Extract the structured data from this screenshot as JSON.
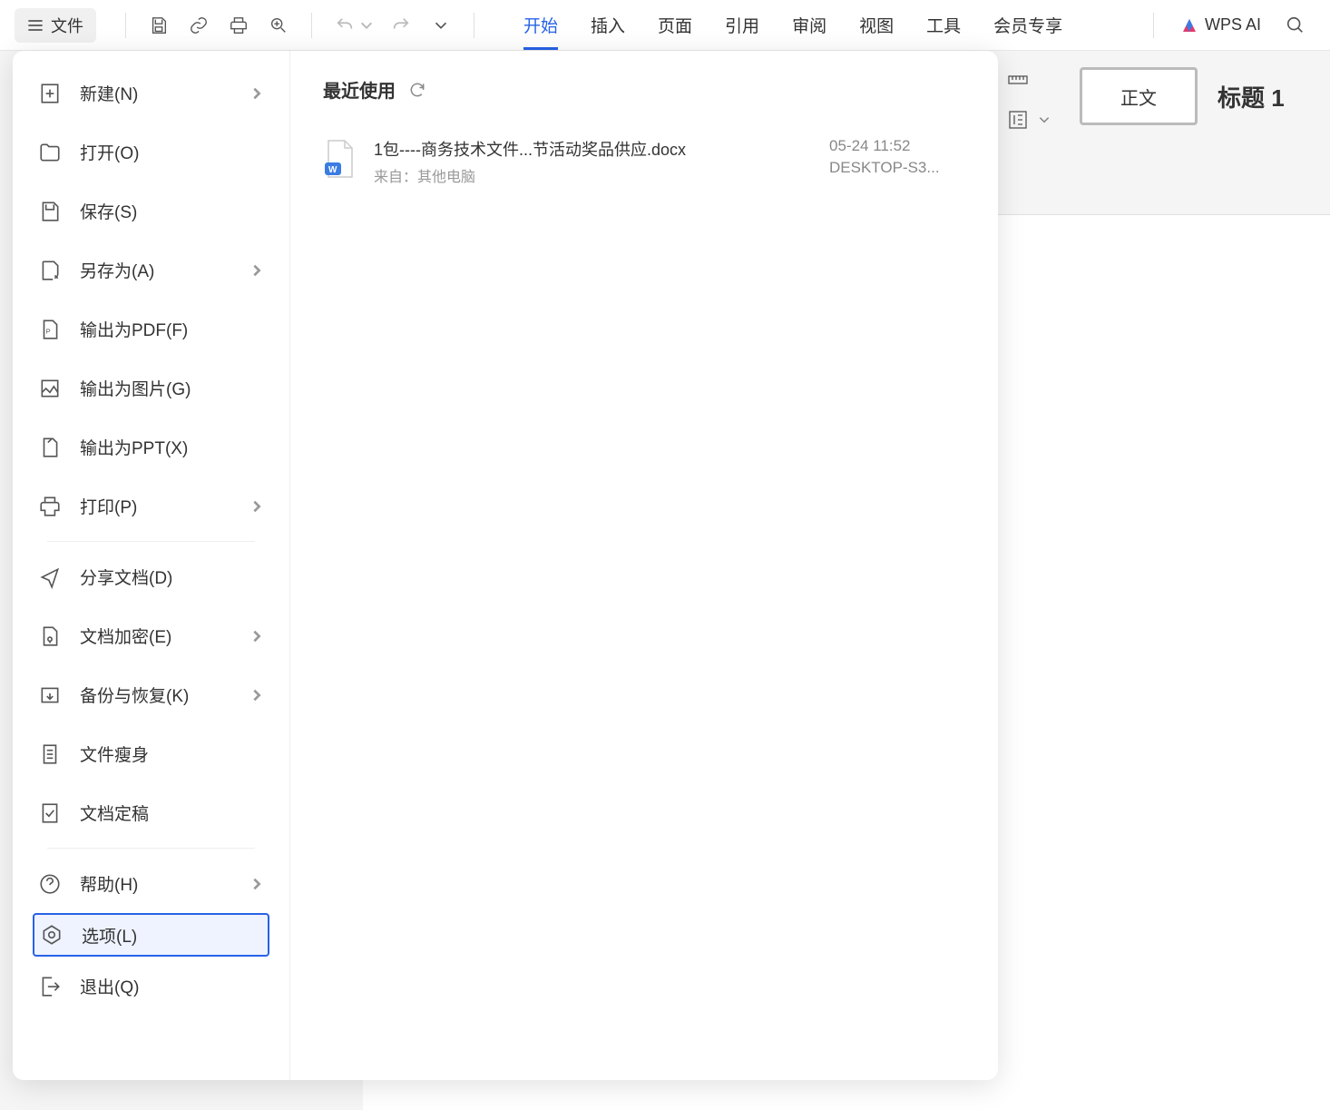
{
  "toolbar": {
    "file_label": "文件"
  },
  "tabs": {
    "start": "开始",
    "insert": "插入",
    "page": "页面",
    "reference": "引用",
    "review": "审阅",
    "view": "视图",
    "tools": "工具",
    "member": "会员专享"
  },
  "wps_ai_label": "WPS AI",
  "file_menu": {
    "new": "新建(N)",
    "open": "打开(O)",
    "save": "保存(S)",
    "save_as": "另存为(A)",
    "export_pdf": "输出为PDF(F)",
    "export_image": "输出为图片(G)",
    "export_ppt": "输出为PPT(X)",
    "print": "打印(P)",
    "share": "分享文档(D)",
    "encrypt": "文档加密(E)",
    "backup": "备份与恢复(K)",
    "slim": "文件瘦身",
    "finalize": "文档定稿",
    "help": "帮助(H)",
    "options": "选项(L)",
    "exit": "退出(Q)"
  },
  "recent": {
    "title": "最近使用",
    "items": [
      {
        "name": "1包----商务技术文件...节活动奖品供应.docx",
        "source": "来自：其他电脑",
        "time": "05-24 11:52",
        "device": "DESKTOP-S3..."
      }
    ]
  },
  "styles": {
    "body_text": "正文",
    "heading": "标题 1"
  }
}
